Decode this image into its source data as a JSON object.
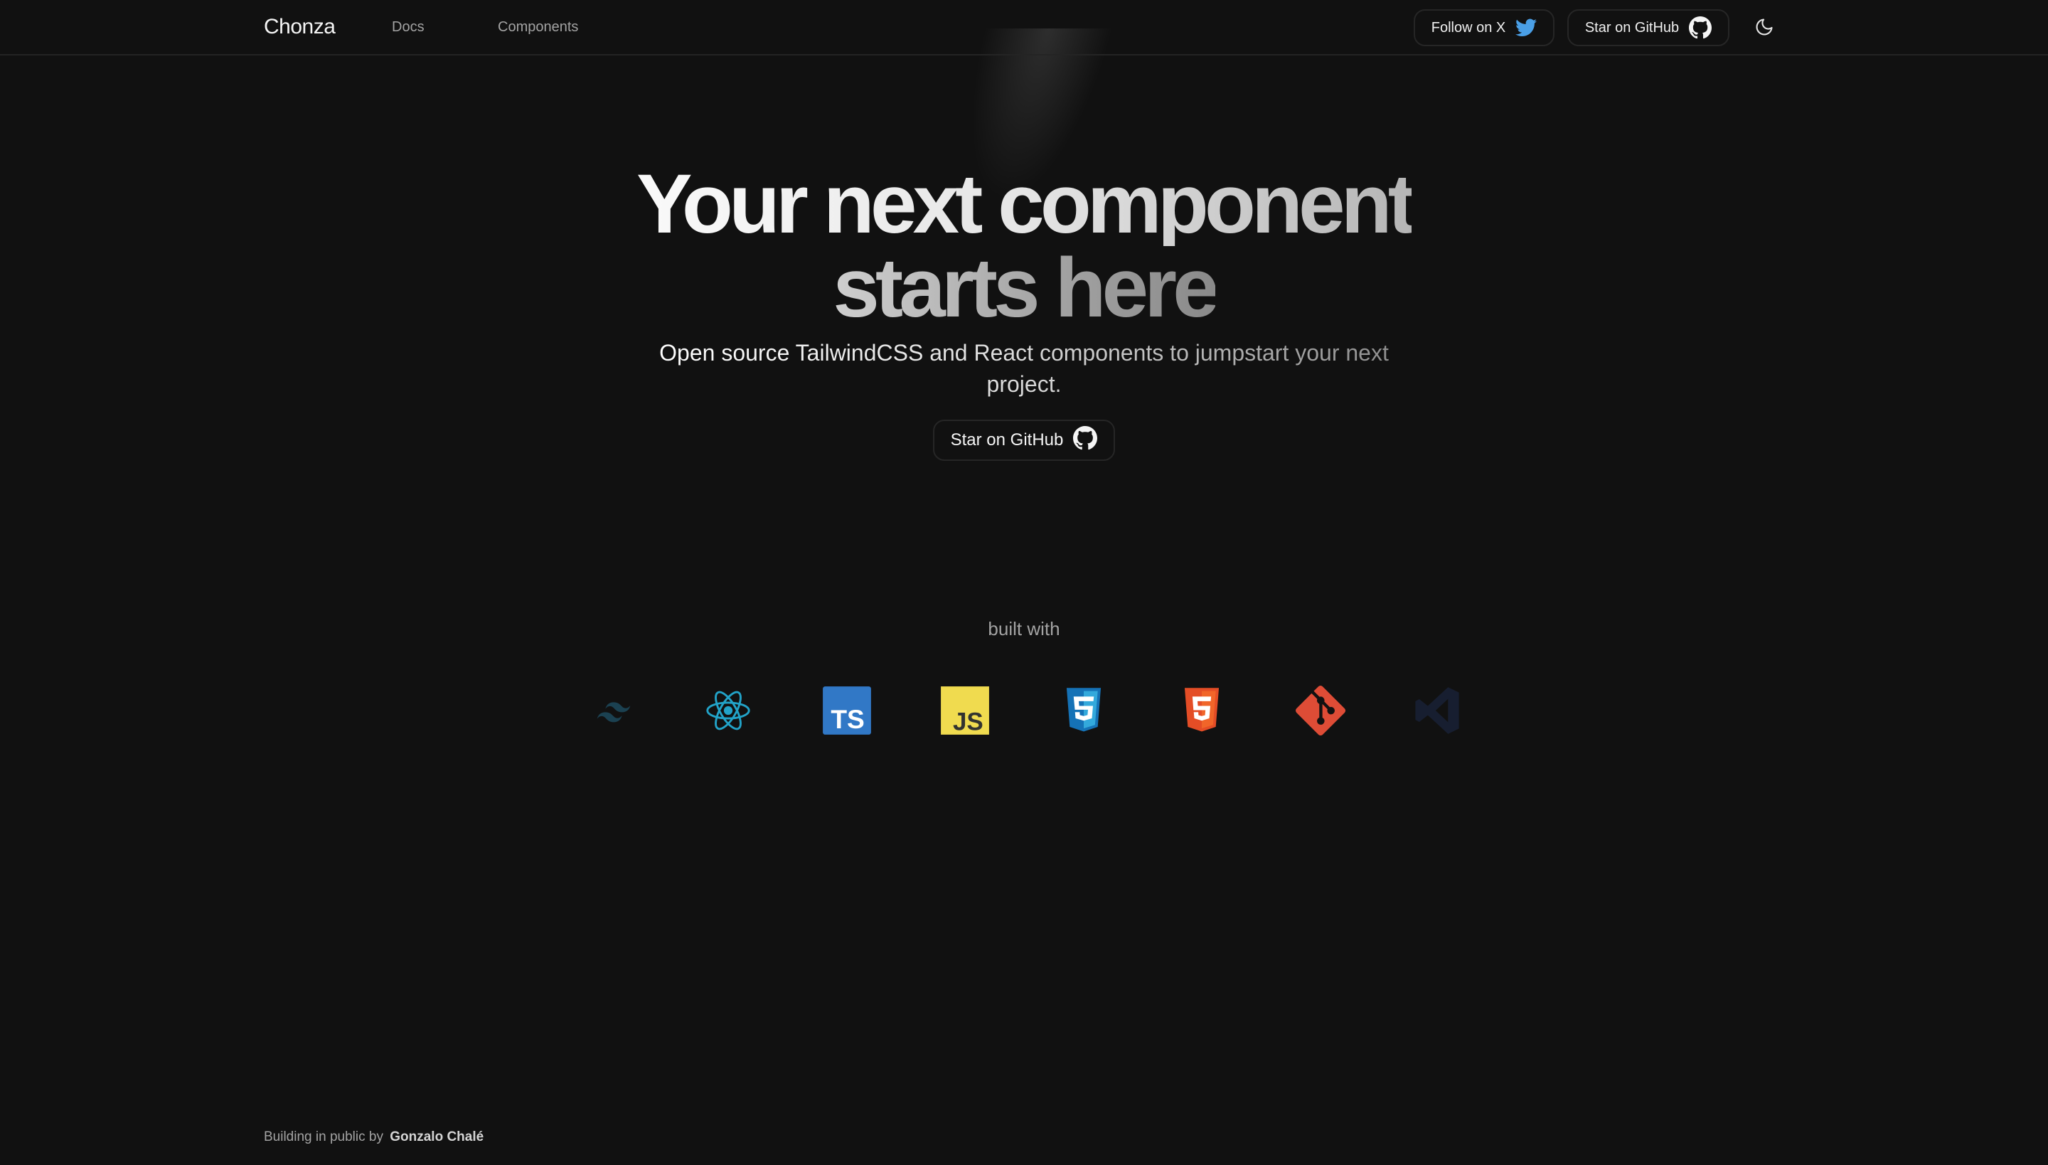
{
  "header": {
    "brand": "Chonza",
    "nav": [
      {
        "label": "Docs"
      },
      {
        "label": "Components"
      }
    ],
    "follow_label": "Follow on X",
    "star_label": "Star on GitHub",
    "icons": {
      "twitter": "twitter-bird-icon",
      "github": "github-icon",
      "theme": "moon-icon"
    }
  },
  "hero": {
    "title_line1": "Your next component",
    "title_line2": "starts here",
    "subtitle": "Open source TailwindCSS and React components to jumpstart your next project.",
    "cta_label": "Star on GitHub"
  },
  "built_with": {
    "label": "built with",
    "logos": [
      {
        "name": "tailwindcss-logo",
        "color": "#38BDF8"
      },
      {
        "name": "react-logo",
        "color": "#22A3C8"
      },
      {
        "name": "typescript-logo",
        "color": "#3178C6"
      },
      {
        "name": "javascript-logo",
        "color": "#F0DB4F"
      },
      {
        "name": "css3-logo",
        "color": "#1572B6"
      },
      {
        "name": "html5-logo",
        "color": "#E44D26"
      },
      {
        "name": "git-logo",
        "color": "#DE4C36"
      },
      {
        "name": "vscode-logo",
        "color": "#23386B"
      }
    ]
  },
  "footer": {
    "prefix": "Building in public by",
    "author": "Gonzalo Chalé"
  },
  "colors": {
    "background": "#111111",
    "border": "#262626",
    "text_muted": "#a3a3a3",
    "twitter_blue": "#4A9FE6"
  }
}
